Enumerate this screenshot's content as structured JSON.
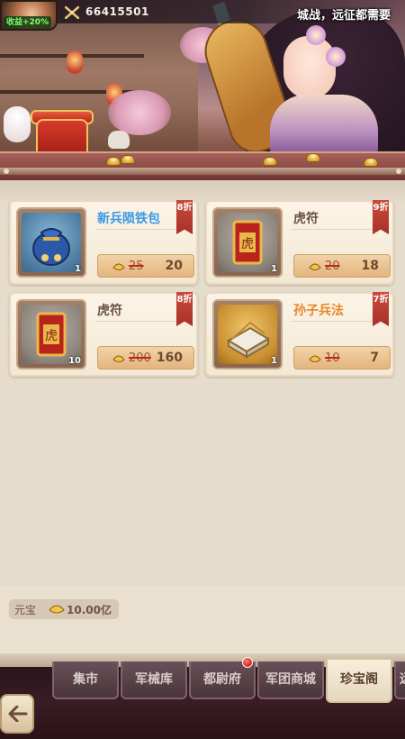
{
  "hud": {
    "income_badge": "收益+20%",
    "gold_amount": "66415501",
    "marquee": "城战，远征都需要"
  },
  "items": [
    {
      "name": "新兵陨铁包",
      "name_color": "blue",
      "icon": "blue-treasure-bag-icon",
      "qty": "1",
      "discount": "8折",
      "old_price": "25",
      "new_price": "20"
    },
    {
      "name": "虎符",
      "name_color": "plain",
      "icon": "tiger-tally-icon",
      "qty": "1",
      "discount": "9折",
      "old_price": "20",
      "new_price": "18"
    },
    {
      "name": "虎符",
      "name_color": "plain",
      "icon": "tiger-tally-icon",
      "qty": "10",
      "discount": "8折",
      "old_price": "200",
      "new_price": "160"
    },
    {
      "name": "孙子兵法",
      "name_color": "orange",
      "icon": "art-of-war-book-icon",
      "qty": "1",
      "discount": "7折",
      "old_price": "10",
      "new_price": "7"
    }
  ],
  "currency": {
    "label": "元宝",
    "value": "10.00亿"
  },
  "tabs": [
    {
      "label": "集市",
      "active": false
    },
    {
      "label": "军械库",
      "active": false
    },
    {
      "label": "都尉府",
      "active": false
    },
    {
      "label": "军团商城",
      "active": false
    },
    {
      "label": "珍宝阁",
      "active": true
    },
    {
      "label": "远",
      "active": false
    }
  ]
}
